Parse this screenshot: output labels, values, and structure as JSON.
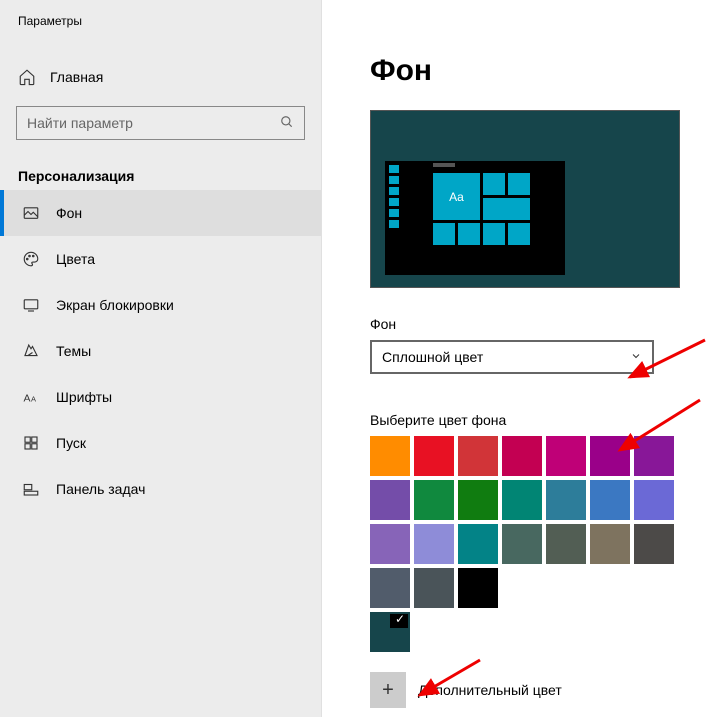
{
  "app": {
    "title": "Параметры"
  },
  "home": {
    "label": "Главная"
  },
  "search": {
    "placeholder": "Найти параметр"
  },
  "section": {
    "label": "Персонализация"
  },
  "nav": {
    "items": [
      {
        "label": "Фон"
      },
      {
        "label": "Цвета"
      },
      {
        "label": "Экран блокировки"
      },
      {
        "label": "Темы"
      },
      {
        "label": "Шрифты"
      },
      {
        "label": "Пуск"
      },
      {
        "label": "Панель задач"
      }
    ]
  },
  "main": {
    "title": "Фон",
    "preview_sample": "Aa",
    "background_label": "Фон",
    "background_dropdown": "Сплошной цвет",
    "choose_color_label": "Выберите цвет фона",
    "custom_color_label": "Дополнительный цвет"
  },
  "colors": {
    "swatches": [
      "#ff8c00",
      "#e81123",
      "#d13438",
      "#c30052",
      "#bf0077",
      "#9a0089",
      "#881798",
      "#744da9",
      "#10893e",
      "#107c10",
      "#018574",
      "#2d7d9a",
      "#3b78c2",
      "#6b69d6",
      "#8764b8",
      "#8e8cd8",
      "#038387",
      "#486860",
      "#525e54",
      "#7e735f",
      "#4c4a48",
      "#515c6b",
      "#4a5459",
      "#000000"
    ],
    "selected": "#16454b"
  }
}
